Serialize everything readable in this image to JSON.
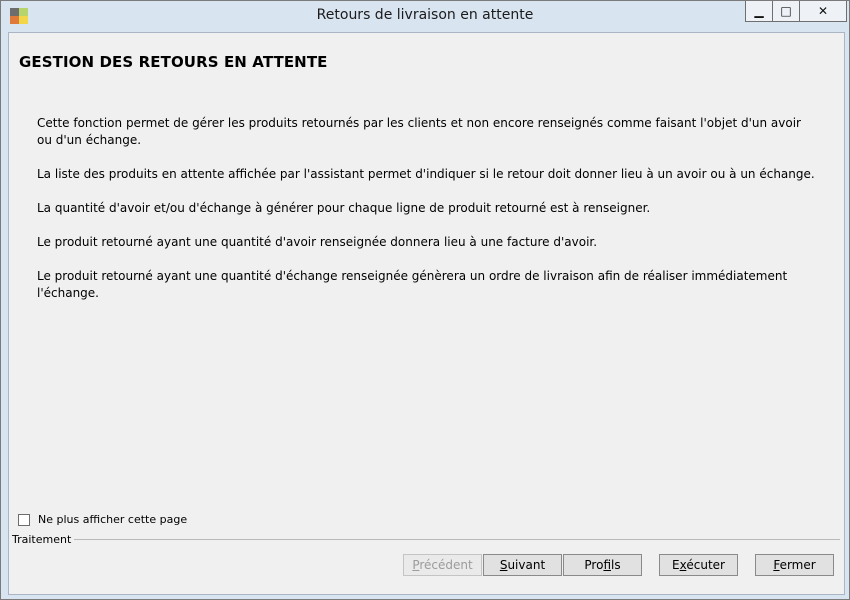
{
  "window": {
    "title": "Retours de livraison en attente",
    "controls": {
      "minimize": "▁",
      "maximize": "□",
      "close": "✕"
    },
    "icon": "app-icon"
  },
  "page": {
    "heading": "GESTION DES RETOURS EN ATTENTE",
    "paragraphs": [
      "Cette fonction permet de gérer les produits retournés par les clients et non encore renseignés comme faisant l'objet d'un avoir ou d'un échange.",
      "La liste des produits en attente affichée par l'assistant permet d'indiquer si le retour doit donner lieu à un avoir ou à un échange.",
      "La quantité d'avoir et/ou d'échange à générer pour chaque ligne de produit retourné est à renseigner.",
      "Le produit retourné ayant une quantité d'avoir renseignée donnera lieu à une facture d'avoir.",
      "Le produit retourné ayant une quantité d'échange renseignée génèrera un ordre de livraison afin de réaliser immédiatement l'échange."
    ],
    "checkbox_label": "Ne plus afficher cette page",
    "checkbox_checked": false,
    "group_label": "Traitement"
  },
  "buttons": {
    "previous": {
      "first": "P",
      "rest": "récédent",
      "enabled": false
    },
    "next": {
      "first": "S",
      "rest": "uivant"
    },
    "profiles": {
      "before": "Pro",
      "mnemonic": "f",
      "after": "ils"
    },
    "execute": {
      "before": "E",
      "mnemonic": "x",
      "after": "écuter"
    },
    "close": {
      "first": "F",
      "rest": "ermer"
    }
  }
}
